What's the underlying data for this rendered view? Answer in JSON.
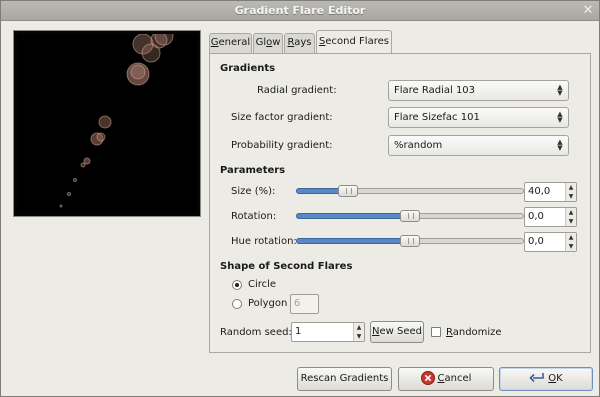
{
  "window": {
    "title": "Gradient Flare Editor"
  },
  "tabs": [
    {
      "label_pre": "",
      "label_key": "G",
      "label_post": "eneral"
    },
    {
      "label_pre": "Gl",
      "label_key": "o",
      "label_post": "w"
    },
    {
      "label_pre": "",
      "label_key": "R",
      "label_post": "ays"
    },
    {
      "label_pre": "",
      "label_key": "S",
      "label_post": "econd Flares"
    }
  ],
  "gradients": {
    "heading": "Gradients",
    "radial_label": "Radial gradient:",
    "radial_value": "Flare Radial 103",
    "size_label": "Size factor gradient:",
    "size_value": "Flare Sizefac 101",
    "prob_label": "Probability gradient:",
    "prob_value": "%random"
  },
  "parameters": {
    "heading": "Parameters",
    "size_label": "Size (%):",
    "size_value": "40,0",
    "size_level_percent": 20,
    "rotation_label": "Rotation:",
    "rotation_value": "0,0",
    "rotation_level_percent": 50,
    "hue_label": "Hue rotation:",
    "hue_value": "0,0",
    "hue_level_percent": 50
  },
  "shape": {
    "heading": "Shape of Second Flares",
    "circle_label": "Circle",
    "polygon_label": "Polygon",
    "polygon_value": "6",
    "selected": "Circle"
  },
  "seed": {
    "label": "Random seed:",
    "value": "1",
    "new_seed_pre": "",
    "new_seed_key": "N",
    "new_seed_post": "ew Seed",
    "randomize_pre": "",
    "randomize_key": "R",
    "randomize_post": "andomize"
  },
  "buttons": {
    "rescan": "Rescan Gradients",
    "cancel_pre": "",
    "cancel_key": "C",
    "cancel_post": "ancel",
    "ok_pre": "",
    "ok_key": "O",
    "ok_post": "K"
  },
  "colors": {
    "accent": "#5c87c5",
    "preview_bg": "#000000",
    "flare": "#e8b8a6"
  }
}
